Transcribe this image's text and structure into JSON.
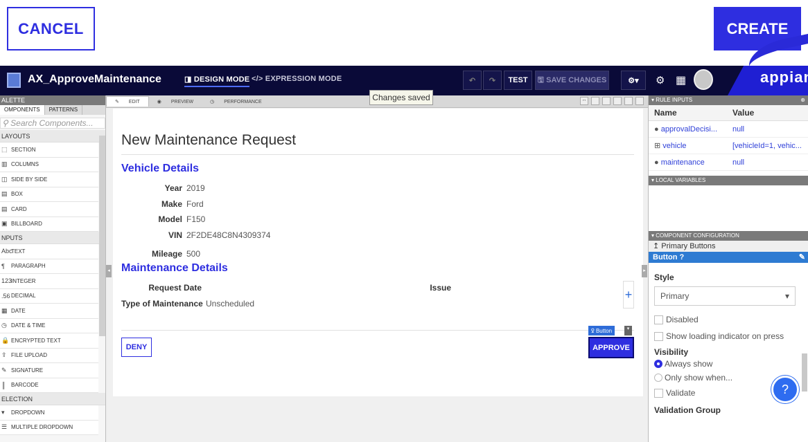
{
  "top": {
    "cancel_label": "CANCEL",
    "create_label": "CREATE"
  },
  "header": {
    "app_title": "AX_ApproveMaintenance",
    "design_mode": "DESIGN MODE",
    "design_mode_icon": "◨",
    "expression_mode": "EXPRESSION MODE",
    "expression_mode_icon": "</>",
    "test_label": "TEST",
    "save_label": "SAVE CHANGES",
    "save_icon": "🖫",
    "logo": "appian"
  },
  "palette": {
    "title": "ALETTE",
    "tabs": [
      "OMPONENTS",
      "PATTERNS"
    ],
    "search_placeholder": "Search Components...",
    "search_icon": "⚲",
    "sections": [
      {
        "title": "LAYOUTS",
        "items": [
          {
            "icon": "⬚",
            "label": "SECTION"
          },
          {
            "icon": "▥",
            "label": "COLUMNS"
          },
          {
            "icon": "◫",
            "label": "SIDE BY SIDE"
          },
          {
            "icon": "▤",
            "label": "BOX"
          },
          {
            "icon": "▤",
            "label": "CARD"
          },
          {
            "icon": "▣",
            "label": "BILLBOARD"
          }
        ]
      },
      {
        "title": "NPUTS",
        "items": [
          {
            "icon": "Abc",
            "label": "TEXT"
          },
          {
            "icon": "¶",
            "label": "PARAGRAPH"
          },
          {
            "icon": "123",
            "label": "INTEGER"
          },
          {
            "icon": ".56",
            "label": "DECIMAL"
          },
          {
            "icon": "▦",
            "label": "DATE"
          },
          {
            "icon": "◷",
            "label": "DATE & TIME"
          },
          {
            "icon": "🔒",
            "label": "ENCRYPTED TEXT"
          },
          {
            "icon": "⇪",
            "label": "FILE UPLOAD"
          },
          {
            "icon": "✎",
            "label": "SIGNATURE"
          },
          {
            "icon": "║",
            "label": "BARCODE"
          }
        ]
      },
      {
        "title": "ELECTION",
        "items": [
          {
            "icon": "▾",
            "label": "DROPDOWN"
          },
          {
            "icon": "☰",
            "label": "MULTIPLE DROPDOWN"
          }
        ]
      }
    ]
  },
  "canvas": {
    "tabs": [
      {
        "icon": "✎",
        "label": "EDIT"
      },
      {
        "icon": "◉",
        "label": "PREVIEW"
      },
      {
        "icon": "◷",
        "label": "PERFORMANCE"
      }
    ],
    "toast": "Changes saved"
  },
  "form": {
    "title": "New Maintenance Request",
    "vehicle_section": "Vehicle Details",
    "vehicle_fields": [
      {
        "label": "Year",
        "value": "2019"
      },
      {
        "label": "Make",
        "value": "Ford"
      },
      {
        "label": "Model",
        "value": "F150"
      },
      {
        "label": "VIN",
        "value": "2F2DE48C8N4309374"
      }
    ],
    "mileage": {
      "label": "Mileage",
      "value": "500"
    },
    "maintenance_section": "Maintenance Details",
    "request_date_label": "Request Date",
    "issue_label": "Issue",
    "type_label": "Type of Maintenance",
    "type_value": "Unscheduled",
    "add_icon": "+",
    "deny_label": "DENY",
    "approve_label": "APPROVE",
    "selection_tag": "Button",
    "selection_tag_icon": "ꝿ"
  },
  "right": {
    "rule_inputs_title": "RULE INPUTS",
    "col_name": "Name",
    "col_value": "Value",
    "rule_inputs": [
      {
        "icon": "●",
        "name": "approvalDecisi...",
        "value": "null"
      },
      {
        "icon": "⊞",
        "name": "vehicle",
        "value": "[vehicleId=1, vehic..."
      },
      {
        "icon": "●",
        "name": "maintenance",
        "value": "null"
      }
    ],
    "local_vars_title": "LOCAL VARIABLES",
    "config_title": "COMPONENT CONFIGURATION",
    "config_sub": "Primary Buttons",
    "config_sub_icon": "↥",
    "config_bar": "Button",
    "config_bar_icon": "?",
    "style_label": "Style",
    "style_value": "Primary",
    "disabled_label": "Disabled",
    "loading_label": "Show loading indicator on press",
    "visibility_label": "Visibility",
    "always_show": "Always show",
    "only_show": "Only show when...",
    "validate_label": "Validate",
    "validation_group_label": "Validation Group"
  },
  "colors": {
    "accent": "#2e2ee0",
    "header_bg": "#0a0a38",
    "config_bar": "#2e7bd2"
  }
}
